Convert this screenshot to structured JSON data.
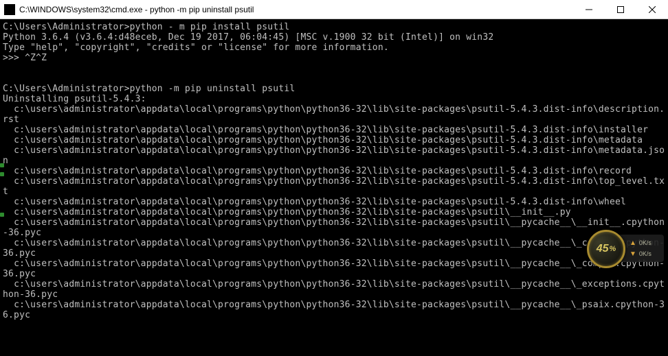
{
  "titlebar": {
    "title": "C:\\WINDOWS\\system32\\cmd.exe - python  -m pip uninstall psutil"
  },
  "terminal": {
    "lines": [
      "C:\\Users\\Administrator>python - m pip install psutil",
      "Python 3.6.4 (v3.6.4:d48eceb, Dec 19 2017, 06:04:45) [MSC v.1900 32 bit (Intel)] on win32",
      "Type \"help\", \"copyright\", \"credits\" or \"license\" for more information.",
      ">>> ^Z^Z",
      "",
      "",
      "C:\\Users\\Administrator>python -m pip uninstall psutil",
      "Uninstalling psutil-5.4.3:",
      "  c:\\users\\administrator\\appdata\\local\\programs\\python\\python36-32\\lib\\site-packages\\psutil-5.4.3.dist-info\\description.rst",
      "  c:\\users\\administrator\\appdata\\local\\programs\\python\\python36-32\\lib\\site-packages\\psutil-5.4.3.dist-info\\installer",
      "  c:\\users\\administrator\\appdata\\local\\programs\\python\\python36-32\\lib\\site-packages\\psutil-5.4.3.dist-info\\metadata",
      "  c:\\users\\administrator\\appdata\\local\\programs\\python\\python36-32\\lib\\site-packages\\psutil-5.4.3.dist-info\\metadata.json",
      "  c:\\users\\administrator\\appdata\\local\\programs\\python\\python36-32\\lib\\site-packages\\psutil-5.4.3.dist-info\\record",
      "  c:\\users\\administrator\\appdata\\local\\programs\\python\\python36-32\\lib\\site-packages\\psutil-5.4.3.dist-info\\top_level.txt",
      "  c:\\users\\administrator\\appdata\\local\\programs\\python\\python36-32\\lib\\site-packages\\psutil-5.4.3.dist-info\\wheel",
      "  c:\\users\\administrator\\appdata\\local\\programs\\python\\python36-32\\lib\\site-packages\\psutil\\__init__.py",
      "  c:\\users\\administrator\\appdata\\local\\programs\\python\\python36-32\\lib\\site-packages\\psutil\\__pycache__\\__init__.cpython-36.pyc",
      "  c:\\users\\administrator\\appdata\\local\\programs\\python\\python36-32\\lib\\site-packages\\psutil\\__pycache__\\_common.cpython-36.pyc",
      "  c:\\users\\administrator\\appdata\\local\\programs\\python\\python36-32\\lib\\site-packages\\psutil\\__pycache__\\_compat.cpython-36.pyc",
      "  c:\\users\\administrator\\appdata\\local\\programs\\python\\python36-32\\lib\\site-packages\\psutil\\__pycache__\\_exceptions.cpython-36.pyc",
      "  c:\\users\\administrator\\appdata\\local\\programs\\python\\python36-32\\lib\\site-packages\\psutil\\__pycache__\\_psaix.cpython-36.pyc"
    ]
  },
  "badge": {
    "percent": "45",
    "pct_sign": "%",
    "up_speed": "0K/s",
    "down_speed": "0K/s"
  },
  "edge_dots_top": [
    238,
    251,
    310
  ]
}
